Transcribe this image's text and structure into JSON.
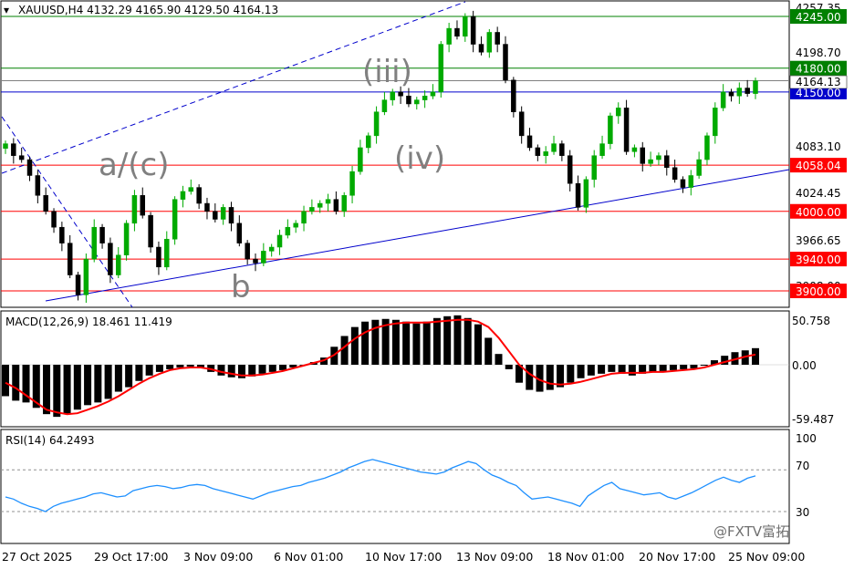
{
  "header": {
    "symbol_text": "XAUUSD,H4  4132.29 4165.90 4129.50 4164.13",
    "macd_text": "MACD(12,26,9) 18.461 11.419",
    "rsi_text": "RSI(14) 64.2493"
  },
  "price_axis": {
    "ticks": [
      "4257.35",
      "4198.70",
      "4083.10",
      "4024.45",
      "3966.65",
      "3908.00"
    ],
    "current_price": "4164.13"
  },
  "macd_axis": {
    "ticks": [
      "50.758",
      "0.00",
      "-59.487"
    ]
  },
  "rsi_axis": {
    "ticks": [
      "100",
      "70",
      "30"
    ]
  },
  "dates": [
    "27 Oct 2025",
    "29 Oct 17:00",
    "3 Nov 09:00",
    "6 Nov 01:00",
    "10 Nov 17:00",
    "13 Nov 09:00",
    "18 Nov 01:00",
    "20 Nov 17:00",
    "25 Nov 09:00"
  ],
  "levels": [
    {
      "label": "4245.00",
      "color": "#008000"
    },
    {
      "label": "4180.00",
      "color": "#008000"
    },
    {
      "label": "4150.00",
      "color": "#0000cc"
    },
    {
      "label": "4058.04",
      "color": "#ff0000"
    },
    {
      "label": "4000.00",
      "color": "#ff0000"
    },
    {
      "label": "3940.00",
      "color": "#ff0000"
    },
    {
      "label": "3900.00",
      "color": "#ff0000"
    }
  ],
  "wave_labels": [
    "(iii)",
    "a/(c)",
    "(iv)",
    "b"
  ],
  "watermark": "@FXTV富拓",
  "colors": {
    "bull": "#00aa00",
    "bear": "#000000",
    "macd_signal": "#ff0000",
    "rsi": "#1e90ff",
    "trend": "#0000cc"
  },
  "chart_data": [
    {
      "type": "candlestick",
      "title": "XAUUSD,H4",
      "values": {
        "open": 4132.29,
        "high": 4165.9,
        "low": 4129.5,
        "close": 4164.13
      },
      "ylim": [
        3888.0,
        4265.0
      ],
      "x_ticks": [
        "27 Oct 2025",
        "29 Oct 17:00",
        "3 Nov 09:00",
        "6 Nov 01:00",
        "10 Nov 17:00",
        "13 Nov 09:00",
        "18 Nov 01:00",
        "20 Nov 17:00",
        "25 Nov 09:00"
      ],
      "close_path": [
        4085,
        4070,
        4065,
        4045,
        4020,
        4000,
        3980,
        3960,
        3920,
        3895,
        3940,
        3980,
        3960,
        3920,
        3945,
        3985,
        4020,
        3995,
        3955,
        3930,
        3965,
        4015,
        4025,
        4030,
        4010,
        4000,
        3990,
        4005,
        3985,
        3960,
        3940,
        3935,
        3950,
        3955,
        3970,
        3980,
        3985,
        4000,
        4005,
        4010,
        4015,
        4000,
        4020,
        4050,
        4080,
        4095,
        4125,
        4140,
        4150,
        4145,
        4135,
        4140,
        4145,
        4150,
        4210,
        4230,
        4220,
        4245,
        4210,
        4200,
        4225,
        4210,
        4165,
        4125,
        4095,
        4080,
        4070,
        4075,
        4085,
        4070,
        4035,
        4005,
        4040,
        4070,
        4085,
        4120,
        4130,
        4075,
        4080,
        4060,
        4065,
        4070,
        4055,
        4040,
        4030,
        4045,
        4065,
        4095,
        4130,
        4150,
        4145,
        4155,
        4148,
        4164
      ],
      "levels": [
        4245.0,
        4180.0,
        4150.0,
        4058.04,
        4000.0,
        3940.0,
        3900.0
      ]
    },
    {
      "type": "bar",
      "title": "MACD(12,26,9)",
      "series": [
        {
          "name": "MACD",
          "values": [
            -35,
            -40,
            -42,
            -48,
            -55,
            -58,
            -55,
            -50,
            -45,
            -42,
            -38,
            -30,
            -25,
            -18,
            -12,
            -8,
            -5,
            -3,
            -2,
            -4,
            -8,
            -12,
            -14,
            -15,
            -13,
            -10,
            -8,
            -6,
            -3,
            0,
            3,
            8,
            20,
            32,
            42,
            48,
            50,
            51,
            50,
            48,
            46,
            48,
            52,
            54,
            55,
            52,
            45,
            30,
            12,
            -5,
            -20,
            -28,
            -30,
            -28,
            -25,
            -20,
            -15,
            -12,
            -10,
            -8,
            -10,
            -12,
            -10,
            -8,
            -7,
            -6,
            -5,
            -4,
            0,
            5,
            10,
            14,
            16,
            18.461
          ]
        },
        {
          "name": "Signal",
          "values": [
            -20,
            -26,
            -34,
            -42,
            -50,
            -53,
            -55,
            -54,
            -50,
            -46,
            -41,
            -35,
            -28,
            -21,
            -15,
            -10,
            -6,
            -4,
            -3,
            -3,
            -5,
            -8,
            -10,
            -12,
            -12,
            -11,
            -9,
            -7,
            -4,
            -1,
            2,
            5,
            11,
            20,
            29,
            36,
            41,
            44,
            46,
            47,
            47,
            47,
            48,
            49,
            50,
            50,
            48,
            42,
            30,
            15,
            0,
            -10,
            -17,
            -21,
            -22,
            -21,
            -19,
            -16,
            -13,
            -10,
            -9,
            -9,
            -9,
            -8,
            -8,
            -7,
            -6,
            -5,
            -3,
            0,
            3,
            6,
            9,
            11.419
          ]
        }
      ],
      "ylim": [
        -59.487,
        50.758
      ]
    },
    {
      "type": "line",
      "title": "RSI(14)",
      "series": [
        {
          "name": "RSI(14)",
          "values": [
            44,
            42,
            38,
            35,
            33,
            30,
            35,
            38,
            40,
            42,
            44,
            47,
            48,
            46,
            44,
            45,
            50,
            52,
            54,
            55,
            54,
            52,
            53,
            55,
            56,
            55,
            52,
            50,
            48,
            46,
            44,
            42,
            45,
            48,
            50,
            52,
            54,
            55,
            58,
            60,
            62,
            65,
            68,
            72,
            75,
            78,
            80,
            78,
            76,
            74,
            72,
            70,
            68,
            67,
            66,
            68,
            72,
            75,
            78,
            76,
            70,
            65,
            62,
            58,
            55,
            48,
            42,
            43,
            44,
            42,
            40,
            38,
            35,
            45,
            50,
            55,
            58,
            52,
            50,
            48,
            46,
            47,
            48,
            44,
            42,
            45,
            48,
            52,
            56,
            60,
            63,
            60,
            58,
            62,
            64.2493
          ]
        }
      ],
      "ylim": [
        0,
        100
      ]
    }
  ]
}
